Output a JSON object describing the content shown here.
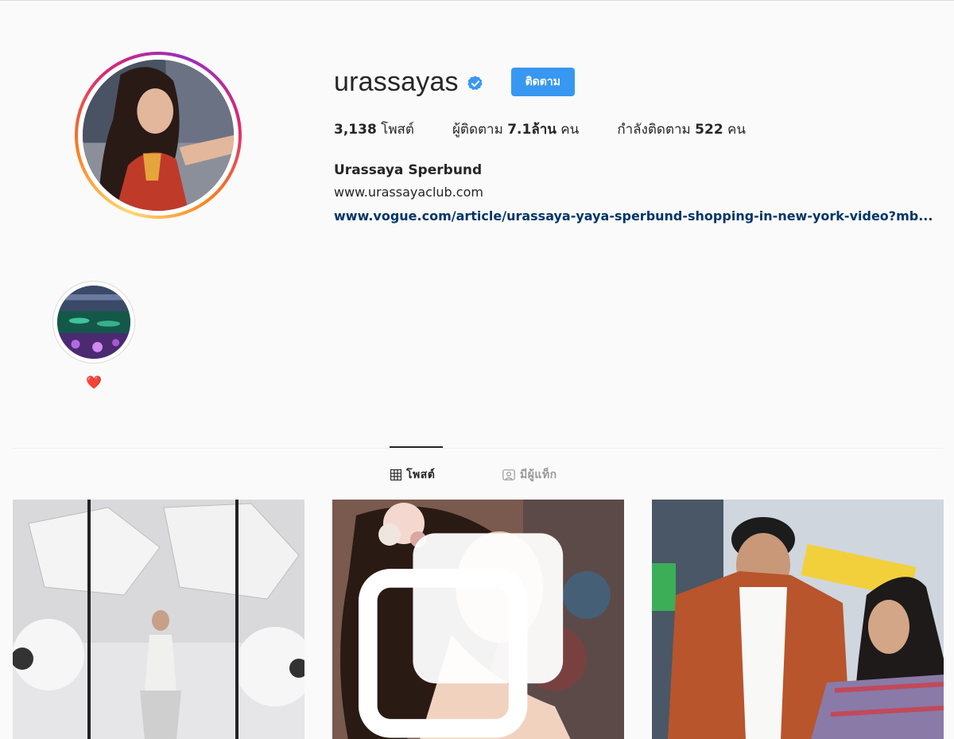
{
  "profile": {
    "username": "urassayas",
    "follow_label": "ติดตาม",
    "stats": {
      "posts_count": "3,138",
      "posts_label": " โพสต์",
      "followers_label": "ผู้ติดตาม ",
      "followers_count": "7.1ล้าน",
      "followers_unit": " คน",
      "following_label": "กำลังติดตาม ",
      "following_count": "522",
      "following_unit": " คน"
    },
    "full_name": "Urassaya Sperbund",
    "bio_website": "www.urassayaclub.com",
    "bio_link": "www.vogue.com/article/urassaya-yaya-sperbund-shopping-in-new-york-video?mb..."
  },
  "highlights": [
    {
      "label": "❤️"
    }
  ],
  "tabs": {
    "posts": "โพสต์",
    "tagged": "มีผู้แท็ก"
  },
  "colors": {
    "accent": "#3897f0",
    "link": "#003569",
    "verified": "#3897f0"
  }
}
